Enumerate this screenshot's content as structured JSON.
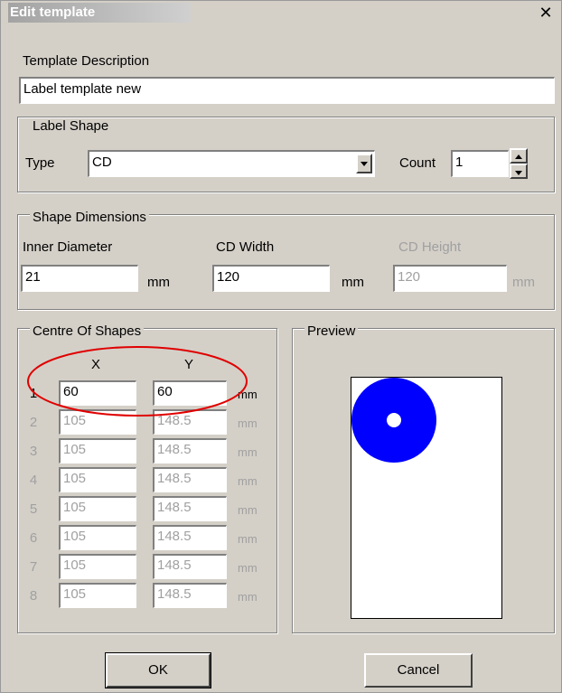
{
  "window": {
    "title": "Edit template",
    "close_glyph": "✕"
  },
  "description": {
    "label": "Template Description",
    "value": "Label template new"
  },
  "label_shape": {
    "legend": "Label Shape",
    "type_label": "Type",
    "type_value": "CD",
    "count_label": "Count",
    "count_value": "1"
  },
  "dimensions": {
    "legend": "Shape Dimensions",
    "inner_label": "Inner Diameter",
    "inner_value": "21",
    "width_label": "CD Width",
    "width_value": "120",
    "height_label": "CD Height",
    "height_value": "120",
    "unit": "mm"
  },
  "centre": {
    "legend": "Centre Of Shapes",
    "x_header": "X",
    "y_header": "Y",
    "unit": "mm",
    "rows": [
      {
        "n": "1",
        "x": "60",
        "y": "60"
      },
      {
        "n": "2",
        "x": "105",
        "y": "148.5"
      },
      {
        "n": "3",
        "x": "105",
        "y": "148.5"
      },
      {
        "n": "4",
        "x": "105",
        "y": "148.5"
      },
      {
        "n": "5",
        "x": "105",
        "y": "148.5"
      },
      {
        "n": "6",
        "x": "105",
        "y": "148.5"
      },
      {
        "n": "7",
        "x": "105",
        "y": "148.5"
      },
      {
        "n": "8",
        "x": "105",
        "y": "148.5"
      }
    ]
  },
  "preview": {
    "legend": "Preview",
    "disc_color": "#0000ff"
  },
  "buttons": {
    "ok": "OK",
    "cancel": "Cancel"
  },
  "colors": {
    "annotation": "#e00000"
  }
}
